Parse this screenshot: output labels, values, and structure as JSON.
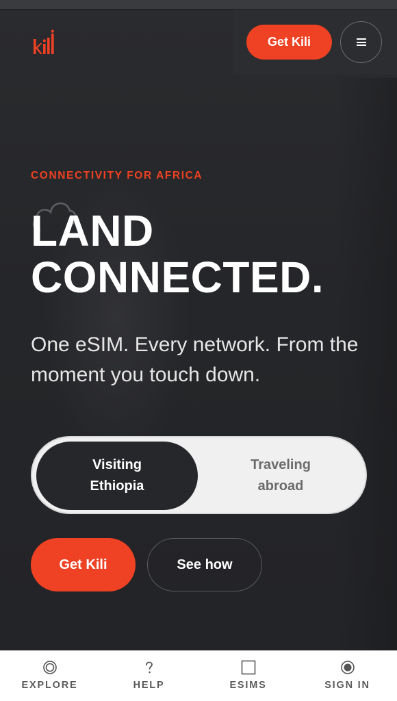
{
  "header": {
    "logo_text": "kili",
    "cta_label": "Get Kili",
    "menu_icon": "hamburger-icon"
  },
  "hero": {
    "eyebrow": "CONNECTIVITY FOR AFRICA",
    "headline_line1": "LAND",
    "headline_line2": "CONNECTED.",
    "subhead": "One eSIM. Every network. From the moment you touch down."
  },
  "toggle": {
    "options": [
      {
        "label": "Visiting Ethiopia",
        "active": true
      },
      {
        "label": "Traveling abroad",
        "active": false
      }
    ]
  },
  "actions": {
    "primary_label": "Get Kili",
    "secondary_label": "See how"
  },
  "bottom_nav": {
    "items": [
      {
        "label": "EXPLORE",
        "icon": "target-icon"
      },
      {
        "label": "HELP",
        "icon": "question-icon"
      },
      {
        "label": "ESIMS",
        "icon": "square-icon"
      },
      {
        "label": "SIGN IN",
        "icon": "radio-dot-icon"
      }
    ]
  },
  "colors": {
    "accent": "#ef4123",
    "background": "#26272a",
    "toggle_bg": "#f0f0f0"
  }
}
